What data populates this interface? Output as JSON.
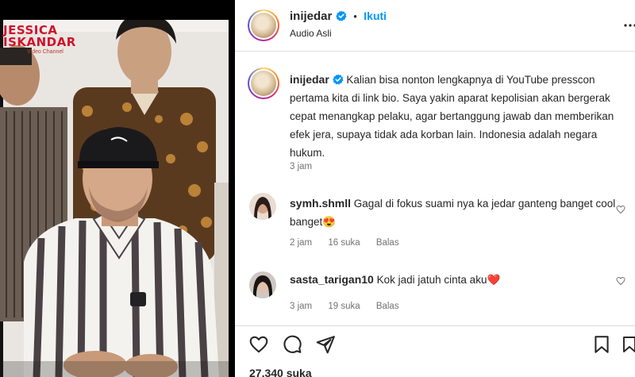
{
  "media": {
    "watermark_line1": "",
    "watermark_line2": "JESSICA",
    "watermark_line3": "ISKANDAR",
    "watermark_line4": "Video Channel"
  },
  "post": {
    "username": "inijedar",
    "follow_label": "Ikuti",
    "audio_label": "Audio Asli",
    "verified": true
  },
  "caption": {
    "username": "inijedar",
    "text": "Kalian bisa nonton lengkapnya di YouTube presscon pertama kita di link bio. Saya yakin aparat kepolisian akan bergerak cepat menangkap pelaku, agar bertanggung jawab dan memberikan efek jera, supaya tidak ada korban lain. Indonesia adalah negara hukum.",
    "time": "3 jam"
  },
  "comments": [
    {
      "username": "symh.shmll",
      "text": "Gagal di fokus suami nya ka jedar ganteng banget cool banget😍",
      "time": "2 jam",
      "likes": "16 suka",
      "reply_label": "Balas"
    },
    {
      "username": "sasta_tarigan10",
      "text": "Kok jadi jatuh cinta aku❤️",
      "time": "3 jam",
      "likes": "19 suka",
      "reply_label": "Balas"
    }
  ],
  "likes_count": "27.340 suka",
  "icons": {
    "like": "heart-icon",
    "comment": "comment-icon",
    "share": "share-icon",
    "save": "bookmark-icon",
    "more": "more-icon"
  },
  "colors": {
    "accent": "#0095f6",
    "verified": "#0095f6",
    "heart_emoji": "#e0245e",
    "watermark": "#d0112b",
    "divider": "#dbdbdb",
    "muted": "#737373"
  }
}
